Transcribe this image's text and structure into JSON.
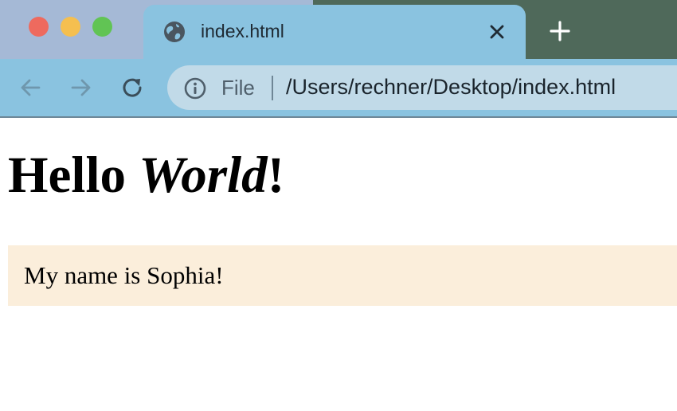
{
  "browser": {
    "tab": {
      "title": "index.html"
    },
    "omnibox": {
      "scheme_label": "File",
      "url": "/Users/rechner/Desktop/index.html"
    },
    "icons": {
      "tab": "globe-icon",
      "tab_close": "close-icon",
      "new_tab": "plus-icon",
      "back": "arrow-left-icon",
      "forward": "arrow-right-icon",
      "reload": "reload-icon",
      "site_info": "info-icon"
    },
    "colors": {
      "tab_strip": "#a5b9d6",
      "desktop": "#4f695a",
      "active_tab": "#8ac3e0",
      "omnibox": "#c1dae8",
      "traffic_close": "#ee6a5e",
      "traffic_minimize": "#f5bf4f",
      "traffic_maximize": "#61c454"
    }
  },
  "page": {
    "heading": {
      "plain": "Hello ",
      "emphasis": "World",
      "suffix": "!"
    },
    "paragraph": "My name is Sophia!",
    "colors": {
      "paragraph_background": "#fbeedb",
      "text": "#000000"
    }
  }
}
